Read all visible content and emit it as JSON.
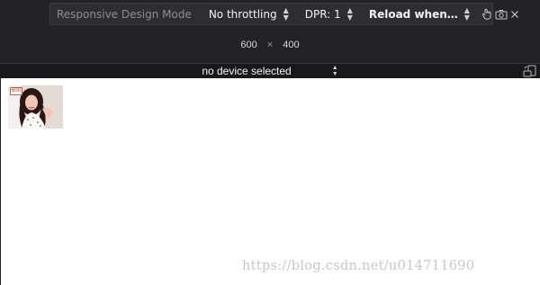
{
  "toolbar": {
    "title": "Responsive Design Mode",
    "throttling": "No throttling",
    "dpr": "DPR: 1",
    "reload": "Reload when…",
    "icons": [
      "touch-icon",
      "screenshot-camera-icon",
      "close-icon"
    ]
  },
  "dimensions": {
    "width": "600",
    "separator": "×",
    "height": "400"
  },
  "device": {
    "label": "no device selected",
    "rotate_icon": "rotate-device-icon"
  },
  "viewport": {
    "image_badge": "600",
    "watermark": "https://blog.csdn.net/u014711690"
  },
  "colors": {
    "toolbar_bg": "#2e2e32",
    "page_bg": "#232327",
    "viewport_bg": "#ffffff"
  }
}
